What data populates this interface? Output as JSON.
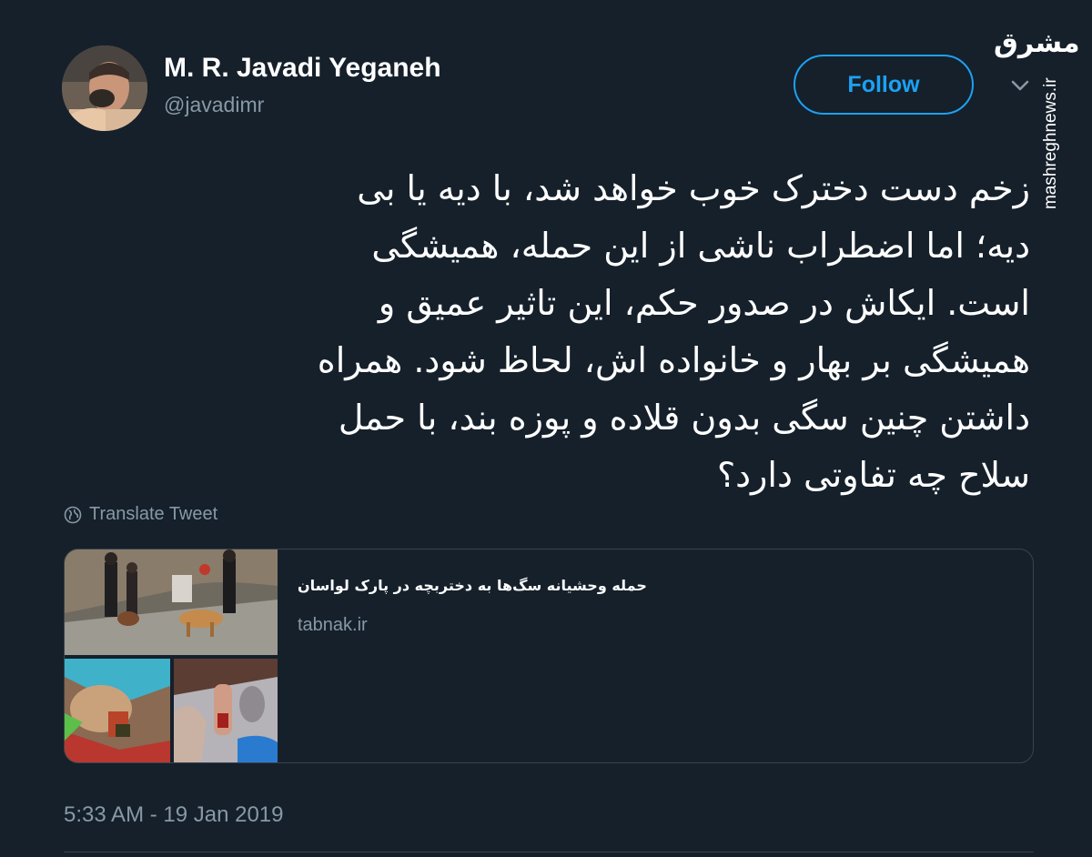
{
  "author": {
    "display_name": "M. R. Javadi Yeganeh",
    "handle": "@javadimr"
  },
  "follow_label": "Follow",
  "watermark": {
    "logo_text": "مشرق",
    "site": "mashreghnews.ir"
  },
  "tweet": {
    "lines": [
      "زخم دست دخترک خوب خواهد شد، با دیه یا بی",
      "دیه؛ اما اضطراب ناشی از این حمله، همیشگی",
      "است. ایکاش در صدور حکم، این تاثیر عمیق و",
      "همیشگی بر بهار و خانواده اش، لحاظ شود. همراه",
      "داشتن چنین سگی بدون قلاده و پوزه بند، با حمل",
      "سلاح چه تفاوتی دارد؟"
    ]
  },
  "translate_label": "Translate Tweet",
  "card": {
    "title": "حمله وحشیانه سگ‌ها به دختربچه در پارک لواسان",
    "domain": "tabnak.ir"
  },
  "timestamp": "5:33 AM - 19 Jan 2019",
  "colors": {
    "background": "#15202b",
    "accent": "#1da1f2",
    "muted": "#8899a6",
    "border": "#38444d"
  }
}
